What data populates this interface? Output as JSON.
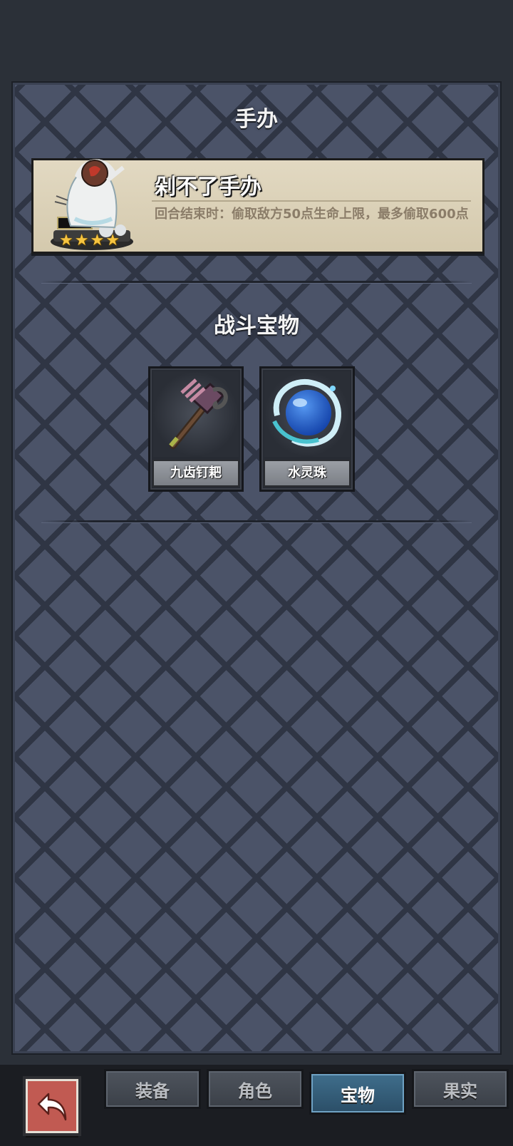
{
  "figure_section": {
    "title": "手办",
    "card": {
      "name": "剁不了手办",
      "description": "回合结束时：偷取敌方50点生命上限，最多偷取600点",
      "stars": 4
    }
  },
  "treasure_section": {
    "title": "战斗宝物",
    "items": [
      {
        "name": "九齿钉耙",
        "icon": "rake-icon"
      },
      {
        "name": "水灵珠",
        "icon": "water-orb-icon"
      }
    ]
  },
  "tabs": [
    {
      "label": "装备",
      "active": false
    },
    {
      "label": "角色",
      "active": false
    },
    {
      "label": "宝物",
      "active": true
    },
    {
      "label": "果实",
      "active": false
    }
  ],
  "back_button": {
    "icon": "back-arrow-icon"
  }
}
